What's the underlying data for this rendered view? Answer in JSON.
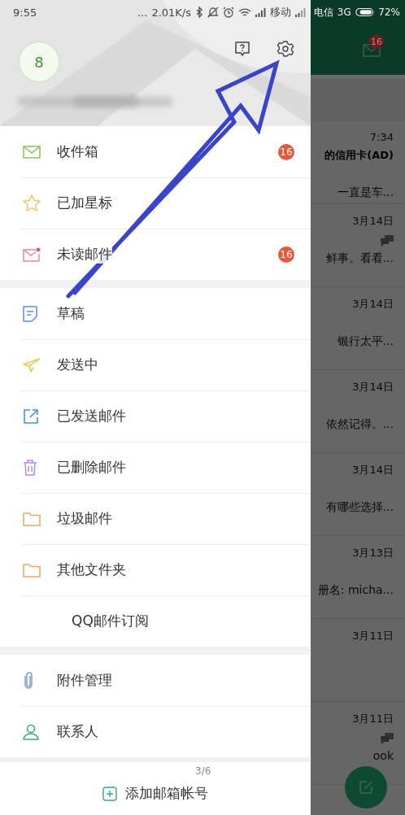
{
  "status_bar": {
    "time": "9:55",
    "dots": "...",
    "net_speed": "2.01K/s",
    "carrier_1": "移动",
    "carrier_2": "电信",
    "network": "3G",
    "battery": "72%"
  },
  "drawer": {
    "avatar": "8",
    "sections": [
      {
        "items": [
          {
            "kind": "inbox",
            "label": "收件箱",
            "badge": "16"
          },
          {
            "kind": "starred",
            "label": "已加星标"
          },
          {
            "kind": "unread",
            "label": "未读邮件",
            "badge": "16"
          }
        ]
      },
      {
        "items": [
          {
            "kind": "drafts",
            "label": "草稿"
          },
          {
            "kind": "sending",
            "label": "发送中"
          },
          {
            "kind": "sent",
            "label": "已发送邮件"
          },
          {
            "kind": "deleted",
            "label": "已删除邮件"
          },
          {
            "kind": "folder",
            "label": "垃圾邮件"
          },
          {
            "kind": "folder",
            "label": "其他文件夹"
          },
          {
            "kind": "subscription",
            "label": "QQ邮件订阅"
          }
        ]
      },
      {
        "items": [
          {
            "kind": "attachments",
            "label": "附件管理"
          },
          {
            "kind": "contacts",
            "label": "联系人"
          }
        ]
      }
    ],
    "footer": {
      "page": "3/6",
      "add_account": "添加邮箱帐号"
    }
  },
  "mail_list": {
    "header_badge": "16",
    "items": [
      {
        "time": "7:34",
        "subject": "的信用卡(AD)",
        "preview": "一直是车...",
        "replied": false
      },
      {
        "time": "3月14日",
        "preview": "鲜事。看看...",
        "replied": true
      },
      {
        "time": "3月14日",
        "preview": "银行太平...",
        "replied": false
      },
      {
        "time": "3月14日",
        "preview": "依然记得。...",
        "replied": false
      },
      {
        "time": "3月14日",
        "preview": "有哪些选择...",
        "replied": false
      },
      {
        "time": "3月13日",
        "preview": "册名: micha...",
        "replied": false
      },
      {
        "time": "3月11日",
        "replied": false
      },
      {
        "time": "3月11日",
        "preview": "ook",
        "replied": true
      }
    ]
  }
}
